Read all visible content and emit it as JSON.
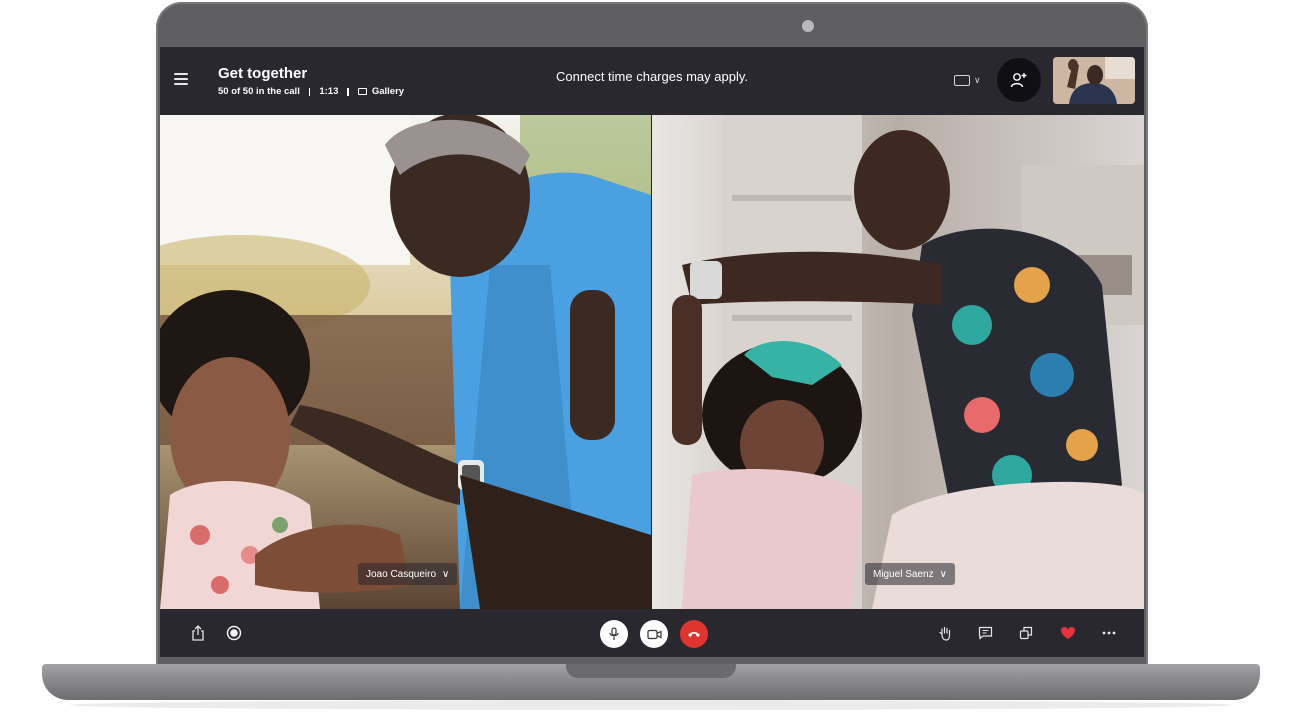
{
  "call": {
    "title": "Get together",
    "participants": "50 of 50 in the call",
    "duration": "1:13",
    "view_mode": "Gallery",
    "notice": "Connect time charges may apply."
  },
  "participants": [
    {
      "name": "Joao Casqueiro"
    },
    {
      "name": "Miguel Saenz"
    }
  ],
  "icons": {
    "menu": "hamburger-menu-icon",
    "layout": "layout-frame-icon",
    "add_person": "add-person-icon",
    "share": "share-icon",
    "record": "record-icon",
    "mic": "microphone-icon",
    "video": "video-camera-icon",
    "end_call": "hang-up-icon",
    "raise_hand": "raise-hand-icon",
    "chat": "chat-icon",
    "switch_view": "switch-view-icon",
    "react": "heart-icon",
    "more": "more-icon"
  },
  "colors": {
    "toolbar": "#29282f",
    "end_call": "#e0342e",
    "heart": "#e8333c"
  }
}
